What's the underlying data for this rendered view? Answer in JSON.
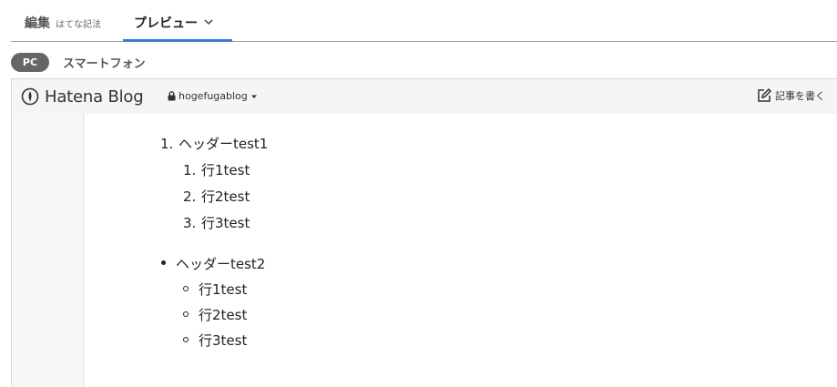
{
  "editor_tabs": {
    "edit_label": "編集",
    "edit_sublabel": "はてな記法",
    "preview_label": "プレビュー"
  },
  "device_switch": {
    "pc_label": "PC",
    "smartphone_label": "スマートフォン"
  },
  "blog_header": {
    "logo_text": "Hatena Blog",
    "blog_name": "hogefugablog",
    "write_label": "記事を書く"
  },
  "content": {
    "ordered_list": {
      "number": "1.",
      "heading": "ヘッダーtest1",
      "items": [
        {
          "number": "1.",
          "text": "行1test"
        },
        {
          "number": "2.",
          "text": "行2test"
        },
        {
          "number": "3.",
          "text": "行3test"
        }
      ]
    },
    "unordered_list": {
      "heading": "ヘッダーtest2",
      "items": [
        {
          "text": "行1test"
        },
        {
          "text": "行2test"
        },
        {
          "text": "行3test"
        }
      ]
    }
  },
  "colors": {
    "accent_underline": "#3a7bd5",
    "pill_background": "#666666"
  },
  "icons": [
    "chevron-down-icon",
    "hatena-logo-icon",
    "lock-icon",
    "caret-down-icon",
    "edit-icon"
  ]
}
